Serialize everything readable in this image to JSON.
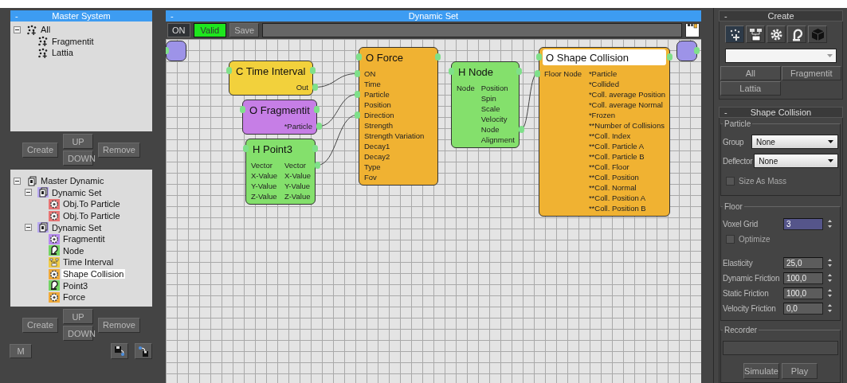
{
  "master_system": {
    "collapse": "-",
    "title": "Master System",
    "tree": [
      {
        "label": "All",
        "kind": "system",
        "expanded": true,
        "selected": false,
        "children": [
          {
            "label": "Fragmentit",
            "kind": "system",
            "selected": false
          },
          {
            "label": "Lattia",
            "kind": "system",
            "selected": false
          }
        ]
      }
    ],
    "buttons": [
      {
        "label": "Create",
        "kind": "create"
      },
      {
        "label": "UP",
        "kind": "up"
      },
      {
        "label": "DOWN",
        "kind": "down"
      },
      {
        "label": "Remove",
        "kind": "remove"
      }
    ]
  },
  "master_dynamic": {
    "tree": [
      {
        "label": "Master Dynamic",
        "kind": "set",
        "expanded": true,
        "selected": false,
        "children": [
          {
            "label": "Dynamic Set",
            "kind": "set",
            "color": "#b9a9f2",
            "expanded": true,
            "selected": false,
            "children": [
              {
                "label": "Obj.To Particle",
                "kind": "operator",
                "color": "#e87474",
                "selected": false
              },
              {
                "label": "Obj.To Particle",
                "kind": "operator",
                "color": "#e87474",
                "selected": false
              }
            ]
          },
          {
            "label": "Dynamic Set",
            "kind": "set",
            "color": "#b9a9f2",
            "expanded": true,
            "selected": false,
            "children": [
              {
                "label": "Fragmentit",
                "kind": "operator",
                "color": "#b68af0",
                "selected": false
              },
              {
                "label": "Node",
                "kind": "helper",
                "color": "#74d464",
                "selected": false
              },
              {
                "label": "Time Interval",
                "kind": "condition",
                "color": "#f0cc48",
                "selected": false
              },
              {
                "label": "Shape Collision",
                "kind": "operator",
                "color": "#f0aa3a",
                "selected": true
              },
              {
                "label": "Point3",
                "kind": "helper",
                "color": "#74d464",
                "selected": false
              },
              {
                "label": "Force",
                "kind": "operator",
                "color": "#f0aa3a",
                "selected": false
              }
            ]
          }
        ]
      }
    ],
    "buttons": [
      {
        "label": "Create",
        "kind": "create"
      },
      {
        "label": "UP",
        "kind": "up"
      },
      {
        "label": "DOWN",
        "kind": "down"
      },
      {
        "label": "Remove",
        "kind": "remove"
      }
    ],
    "m_button": "M"
  },
  "dynamic_set": {
    "collapse": "-",
    "title": "Dynamic Set",
    "toolbar": [
      {
        "label": "ON",
        "kind": "toggle"
      },
      {
        "label": "Valid",
        "kind": "status"
      },
      {
        "label": "Save",
        "kind": "action"
      }
    ],
    "nodes": [
      {
        "kind": "terminal",
        "color": "#9d93e8",
        "selected": false
      },
      {
        "kind": "node",
        "title": "C Time Interval",
        "color": "#f2d13c",
        "selected": false,
        "outputs": [
          {
            "label": "Out",
            "connected": true
          }
        ]
      },
      {
        "kind": "node",
        "title": "O Fragmentit",
        "color": "#c67ee6",
        "selected": false,
        "outputs": [
          {
            "label": "*Particle",
            "connected": true
          }
        ]
      },
      {
        "kind": "node",
        "title": "H Point3",
        "color": "#84e06c",
        "selected": false,
        "inputs": [
          {
            "label": "Vector",
            "connected": false
          },
          {
            "label": "X-Value",
            "connected": false
          },
          {
            "label": "Y-Value",
            "connected": false
          },
          {
            "label": "Z-Value",
            "connected": false
          }
        ],
        "outputs": [
          {
            "label": "Vector",
            "connected": true
          },
          {
            "label": "X-Value",
            "connected": false
          },
          {
            "label": "Y-Value",
            "connected": false
          },
          {
            "label": "Z-Value",
            "connected": false
          }
        ]
      },
      {
        "kind": "node",
        "title": "O Force",
        "color": "#f0b232",
        "selected": false,
        "inputs": [
          {
            "label": "ON",
            "connected": true
          },
          {
            "label": "Time",
            "connected": false
          },
          {
            "label": "Particle",
            "connected": true
          },
          {
            "label": "Position",
            "connected": false
          },
          {
            "label": "Direction",
            "connected": true
          },
          {
            "label": "Strength",
            "connected": false
          },
          {
            "label": "Strength Variation",
            "connected": false
          },
          {
            "label": "Decay1",
            "connected": false
          },
          {
            "label": "Decay2",
            "connected": false
          },
          {
            "label": "Type",
            "connected": false
          },
          {
            "label": "Fov",
            "connected": false
          }
        ]
      },
      {
        "kind": "node",
        "title": "H Node",
        "color": "#84e06c",
        "selected": false,
        "inputs": [
          {
            "label": "Node",
            "connected": false
          }
        ],
        "outputs": [
          {
            "label": "Position",
            "connected": false
          },
          {
            "label": "Spin",
            "connected": false
          },
          {
            "label": "Scale",
            "connected": false
          },
          {
            "label": "Velocity",
            "connected": false
          },
          {
            "label": "Node",
            "connected": true
          },
          {
            "label": "Alignment",
            "connected": false
          }
        ]
      },
      {
        "kind": "node",
        "title": "O Shape Collision",
        "color": "#f0b232",
        "selected": true,
        "inputs": [
          {
            "label": "Floor Node",
            "connected": true
          }
        ],
        "outputs": [
          {
            "label": "*Particle",
            "connected": false
          },
          {
            "label": "*Collided",
            "connected": false
          },
          {
            "label": "*Coll. average Position",
            "connected": false
          },
          {
            "label": "*Coll. average Normal",
            "connected": false
          },
          {
            "label": "*Frozen",
            "connected": false
          },
          {
            "label": "**Number of Collisions",
            "connected": false
          },
          {
            "label": "**Coll. Index",
            "connected": false
          },
          {
            "label": "**Coll. Particle A",
            "connected": false
          },
          {
            "label": "**Coll. Particle B",
            "connected": false
          },
          {
            "label": "**Coll. Floor",
            "connected": false
          },
          {
            "label": "**Coll. Position",
            "connected": false
          },
          {
            "label": "**Coll. Normal",
            "connected": false
          },
          {
            "label": "**Coll. Position A",
            "connected": false
          },
          {
            "label": "**Coll. Position B",
            "connected": false
          }
        ]
      },
      {
        "kind": "terminal",
        "color": "#9d93e8",
        "selected": false
      }
    ]
  },
  "create": {
    "collapse": "-",
    "title": "Create",
    "buttons": [
      "All",
      "Fragmentit",
      "Lattia"
    ]
  },
  "shape_collision": {
    "collapse": "-",
    "title": "Shape Collision",
    "particle": {
      "title": "Particle",
      "dropdowns": [
        {
          "label": "Group",
          "value": "None"
        },
        {
          "label": "Deflector",
          "value": "None"
        }
      ],
      "size_as_mass": {
        "label": "Size As Mass",
        "checked": false
      }
    },
    "floor": {
      "title": "Floor",
      "voxel_grid": {
        "label": "Voxel Grid",
        "value": "3"
      },
      "optimize": {
        "label": "Optimize",
        "checked": false
      },
      "spinners": [
        {
          "label": "Elasticity",
          "value": "25,0"
        },
        {
          "label": "Dynamic Friction",
          "value": "100,0"
        },
        {
          "label": "Static Friction",
          "value": "100,0"
        },
        {
          "label": "Velocity Friction",
          "value": "0,0"
        }
      ]
    },
    "recorder": {
      "title": "Recorder",
      "buttons": [
        "Simulate",
        "Play"
      ]
    }
  }
}
